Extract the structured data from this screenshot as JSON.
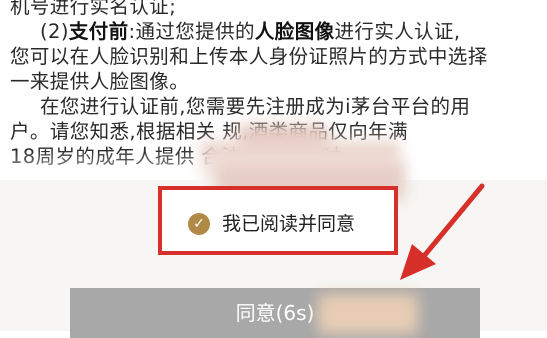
{
  "document": {
    "line1": "机号进行实名认证;",
    "para2_num": "(2)",
    "para2_lead": "支付前",
    "para2_mid": ":通过您提供的",
    "para2_bold2": "人脸图像",
    "para2_rest": "进行实人认证,",
    "line3": "您可以在人脸识别和上传本人身份证照片的方式中选择",
    "line4": "一来提供人脸图像。",
    "line5": "在您进行认证前,您需要先注册成为i茅台平台的用",
    "line6": "户。请您知悉,根据相关        规,酒类商品仅向年满",
    "line7": "18周岁的成年人提供                    合法权益。同时"
  },
  "agreement": {
    "checked": true,
    "check_glyph": "✓",
    "label": "我已阅读并同意",
    "highlight_color": "#d7302b"
  },
  "confirm_button": {
    "label": "同意(6s)",
    "enabled": false
  },
  "colors": {
    "accent": "#b08a46",
    "disabled": "#a8a8a8",
    "annotation": "#d7302b"
  }
}
